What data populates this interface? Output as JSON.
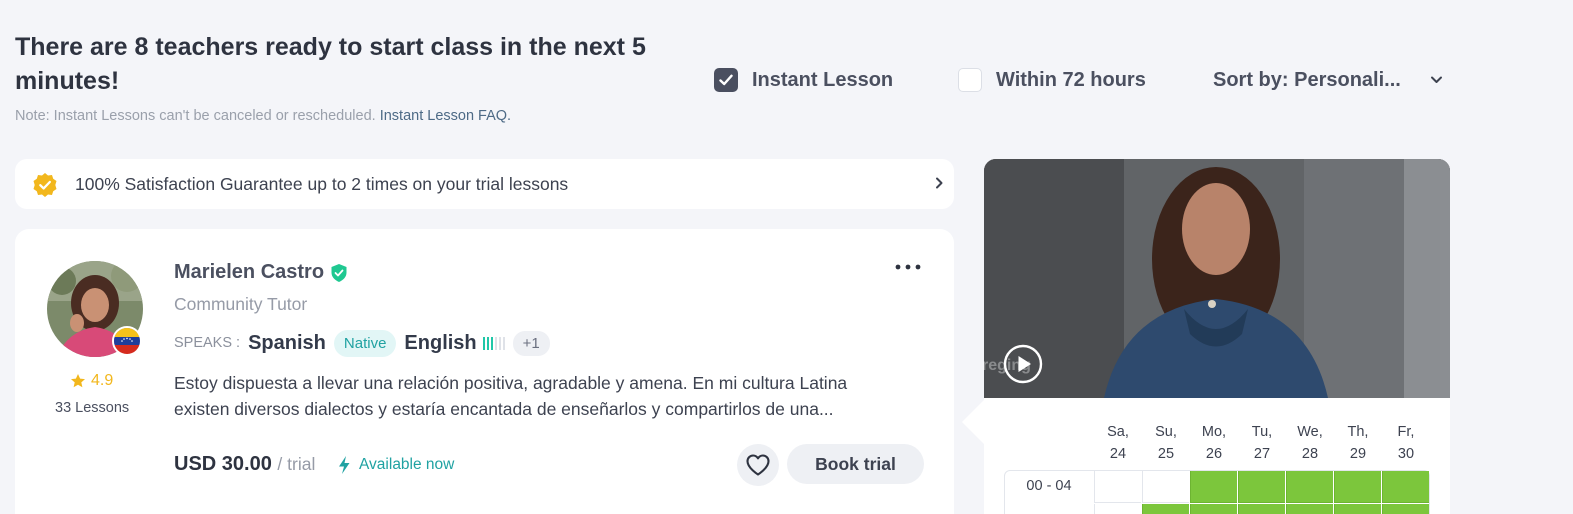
{
  "header": {
    "headline": "There are 8 teachers ready to start class in the next 5 minutes!",
    "note_prefix": "Note: Instant Lessons can't be canceled or rescheduled.",
    "note_link": "Instant Lesson FAQ."
  },
  "filters": {
    "instant_label": "Instant Lesson",
    "instant_checked": true,
    "within72_label": "Within 72 hours",
    "within72_checked": false,
    "sort_label": "Sort by: Personali..."
  },
  "guarantee": {
    "text": "100% Satisfaction Guarantee up to 2 times on your trial lessons"
  },
  "teacher": {
    "name": "Marielen Castro",
    "role": "Community Tutor",
    "rating": "4.9",
    "lessons": "33 Lessons",
    "speaks_label": "SPEAKS :",
    "languages": [
      {
        "name": "Spanish",
        "level": "Native"
      },
      {
        "name": "English",
        "level_bars_filled": 3,
        "level_bars_total": 6
      }
    ],
    "more_languages": "+1",
    "description_line1": "Estoy dispuesta a llevar una relación positiva, agradable y amena. En mi cultura Latina",
    "description_line2": "existen diversos dialectos y estaría encantada de enseñarlos y compartirlos de una...",
    "price": "USD 30.00",
    "price_unit": "/ trial",
    "availability": "Available now",
    "book_label": "Book trial",
    "video_watermark": "reging"
  },
  "calendar": {
    "days": [
      {
        "name": "Sa,",
        "num": "24"
      },
      {
        "name": "Su,",
        "num": "25"
      },
      {
        "name": "Mo,",
        "num": "26"
      },
      {
        "name": "Tu,",
        "num": "27"
      },
      {
        "name": "We,",
        "num": "28"
      },
      {
        "name": "Th,",
        "num": "29"
      },
      {
        "name": "Fr,",
        "num": "30"
      }
    ],
    "rows": [
      {
        "label": "00 - 04",
        "available": [
          false,
          false,
          true,
          true,
          true,
          true,
          true
        ]
      },
      {
        "label": "",
        "available": [
          false,
          true,
          true,
          true,
          true,
          true,
          true
        ]
      }
    ],
    "available_color": "#7cc63c"
  },
  "colors": {
    "accent_teal": "#20a2a2",
    "star_gold": "#f2b71d",
    "verified_green": "#1fc891"
  }
}
